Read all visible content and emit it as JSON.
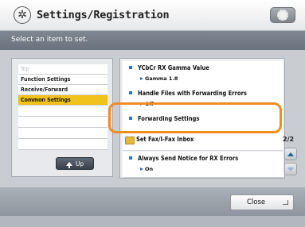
{
  "header": {
    "title": "Settings/Registration",
    "logo_icon": "settings-registration-icon",
    "utility_icon": "gear-icon"
  },
  "instruction": "Select an item to set.",
  "nav": {
    "items": [
      {
        "label": "Top",
        "state": "disabled"
      },
      {
        "label": "Function Settings",
        "state": "normal"
      },
      {
        "label": "Receive/Forward",
        "state": "normal"
      },
      {
        "label": "Common Settings",
        "state": "selected"
      }
    ],
    "up_label": "Up"
  },
  "list": {
    "items": [
      {
        "title": "YCbCr RX Gamma Value",
        "value": "Gamma 1.8"
      },
      {
        "title": "Handle Files with Forwarding Errors",
        "value": "Off"
      },
      {
        "title": "Forwarding Settings",
        "value": ""
      },
      {
        "title": "Set Fax/I-Fax Inbox",
        "value": ""
      },
      {
        "title": "Always Send Notice for RX Errors",
        "value": "On"
      }
    ],
    "highlighted_item": "Forwarding Settings"
  },
  "pagination": {
    "current": "2/2"
  },
  "footer": {
    "close_label": "Close"
  },
  "colors": {
    "selected": "#f1c21b",
    "highlight_ring": "#f28b21",
    "bullet": "#2a73c9"
  }
}
